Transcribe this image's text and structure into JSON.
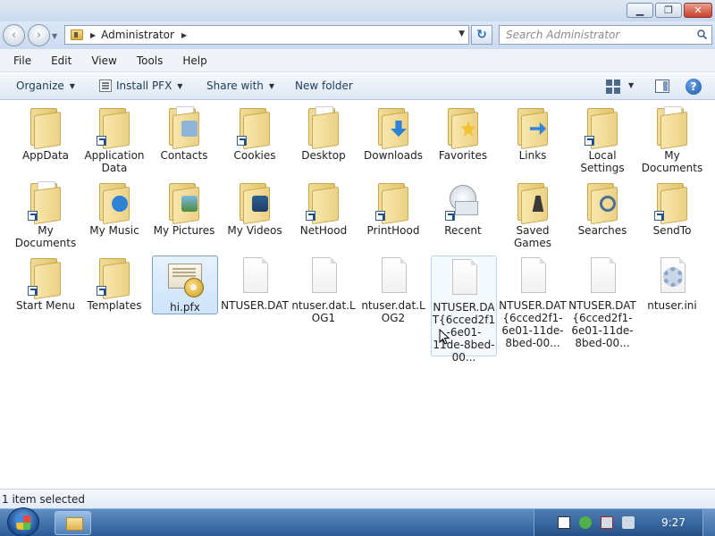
{
  "window": {
    "controls": {
      "minimize": "▁",
      "maximize": "❐",
      "close": "✕"
    }
  },
  "nav": {
    "back_icon": "‹",
    "forward_icon": "›",
    "address_segments": [
      "Administrator"
    ],
    "search_placeholder": "Search Administrator",
    "refresh_icon": "↻"
  },
  "menu": {
    "items": [
      "File",
      "Edit",
      "View",
      "Tools",
      "Help"
    ]
  },
  "toolbar": {
    "organize": "Organize",
    "install_pfx": "Install PFX",
    "share_with": "Share with",
    "new_folder": "New folder",
    "help": "?"
  },
  "content": {
    "items": [
      {
        "label": "AppData",
        "icon": "folder-icon"
      },
      {
        "label": "Application Data",
        "icon": "folder-shortcut-icon"
      },
      {
        "label": "Contacts",
        "icon": "contacts-folder-icon"
      },
      {
        "label": "Cookies",
        "icon": "folder-shortcut-icon"
      },
      {
        "label": "Desktop",
        "icon": "desktop-folder-icon"
      },
      {
        "label": "Downloads",
        "icon": "downloads-folder-icon"
      },
      {
        "label": "Favorites",
        "icon": "favorites-folder-icon"
      },
      {
        "label": "Links",
        "icon": "links-folder-icon"
      },
      {
        "label": "Local Settings",
        "icon": "folder-shortcut-icon"
      },
      {
        "label": "My Documents",
        "icon": "documents-folder-icon"
      },
      {
        "label": "My Documents",
        "icon": "folder-shortcut-icon"
      },
      {
        "label": "My Music",
        "icon": "music-folder-icon"
      },
      {
        "label": "My Pictures",
        "icon": "pictures-folder-icon"
      },
      {
        "label": "My Videos",
        "icon": "videos-folder-icon"
      },
      {
        "label": "NetHood",
        "icon": "folder-shortcut-icon"
      },
      {
        "label": "PrintHood",
        "icon": "folder-shortcut-icon"
      },
      {
        "label": "Recent",
        "icon": "recent-shortcut-icon"
      },
      {
        "label": "Saved Games",
        "icon": "saved-games-folder-icon"
      },
      {
        "label": "Searches",
        "icon": "searches-folder-icon"
      },
      {
        "label": "SendTo",
        "icon": "folder-shortcut-icon"
      },
      {
        "label": "Start Menu",
        "icon": "folder-shortcut-icon"
      },
      {
        "label": "Templates",
        "icon": "folder-shortcut-icon"
      },
      {
        "label": "hi.pfx",
        "icon": "certificate-file-icon"
      },
      {
        "label": "NTUSER.DAT",
        "icon": "file-icon"
      },
      {
        "label": "ntuser.dat.LOG1",
        "icon": "file-icon"
      },
      {
        "label": "ntuser.dat.LOG2",
        "icon": "file-icon"
      },
      {
        "label": "NTUSER.DAT{6cced2f1-6e01-11de-8bed-00...",
        "icon": "file-icon"
      },
      {
        "label": "NTUSER.DAT{6cced2f1-6e01-11de-8bed-00...",
        "icon": "file-icon"
      },
      {
        "label": "NTUSER.DAT{6cced2f1-6e01-11de-8bed-00...",
        "icon": "file-icon"
      },
      {
        "label": "ntuser.ini",
        "icon": "settings-file-icon"
      }
    ]
  },
  "status": {
    "text": "1 item selected"
  },
  "taskbar": {
    "clock": "9:27"
  }
}
